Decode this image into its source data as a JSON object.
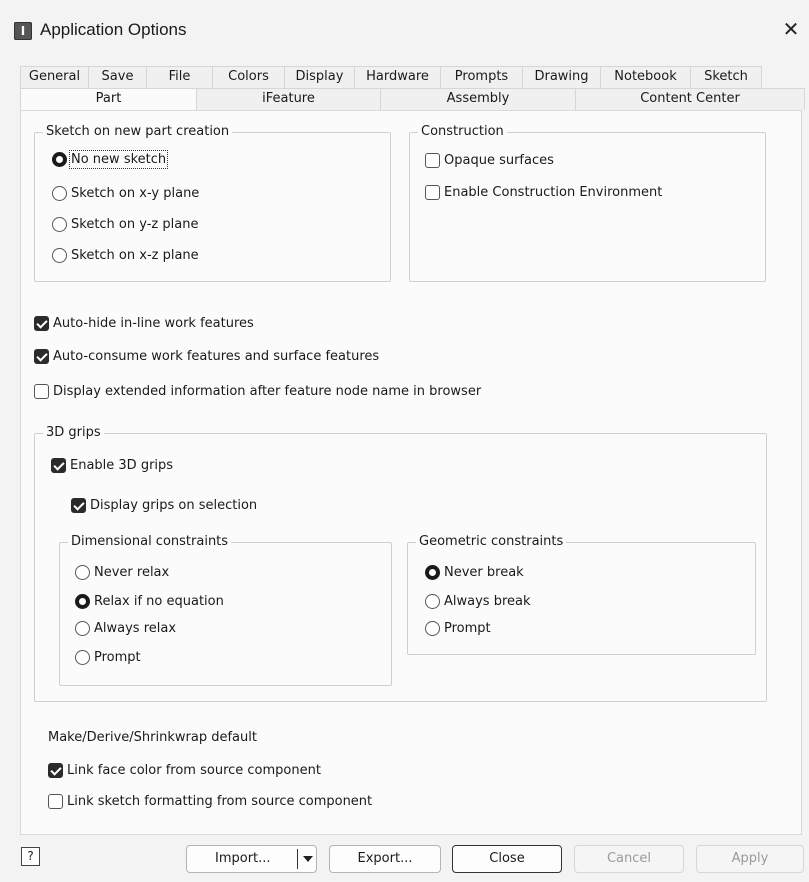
{
  "window": {
    "title": "Application Options",
    "app_icon_letter": "I",
    "close_glyph": "✕"
  },
  "tabs_row1": [
    "General",
    "Save",
    "File",
    "Colors",
    "Display",
    "Hardware",
    "Prompts",
    "Drawing",
    "Notebook",
    "Sketch"
  ],
  "tabs_row2": [
    "Part",
    "iFeature",
    "Assembly",
    "Content Center"
  ],
  "active_tab": "Part",
  "sketch_group": {
    "label": "Sketch on new part creation",
    "options": [
      {
        "label": "No new sketch",
        "selected": true
      },
      {
        "label": "Sketch on x-y plane",
        "selected": false
      },
      {
        "label": "Sketch on y-z plane",
        "selected": false
      },
      {
        "label": "Sketch on x-z plane",
        "selected": false
      }
    ]
  },
  "construction_group": {
    "label": "Construction",
    "options": [
      {
        "label": "Opaque surfaces",
        "checked": false
      },
      {
        "label": "Enable Construction Environment",
        "checked": false
      }
    ]
  },
  "general_checks": [
    {
      "label": "Auto-hide in-line work features",
      "checked": true
    },
    {
      "label": "Auto-consume work features and surface features",
      "checked": true
    },
    {
      "label": "Display extended information after feature node name in browser",
      "checked": false
    }
  ],
  "grips_group": {
    "label": "3D grips",
    "enable": {
      "label": "Enable 3D grips",
      "checked": true
    },
    "display_on_selection": {
      "label": "Display grips on selection",
      "checked": true
    },
    "dimensional": {
      "label": "Dimensional constraints",
      "options": [
        {
          "label": "Never relax",
          "selected": false
        },
        {
          "label": "Relax if no equation",
          "selected": true
        },
        {
          "label": "Always relax",
          "selected": false
        },
        {
          "label": "Prompt",
          "selected": false
        }
      ]
    },
    "geometric": {
      "label": "Geometric constraints",
      "options": [
        {
          "label": "Never break",
          "selected": true
        },
        {
          "label": "Always break",
          "selected": false
        },
        {
          "label": "Prompt",
          "selected": false
        }
      ]
    }
  },
  "make_derive": {
    "label": "Make/Derive/Shrinkwrap default",
    "options": [
      {
        "label": "Link face color from source component",
        "checked": true
      },
      {
        "label": "Link sketch formatting from source component",
        "checked": false
      }
    ]
  },
  "footer": {
    "help_glyph": "?",
    "import_label": "Import...",
    "export_label": "Export...",
    "close_label": "Close",
    "cancel_label": "Cancel",
    "apply_label": "Apply"
  }
}
